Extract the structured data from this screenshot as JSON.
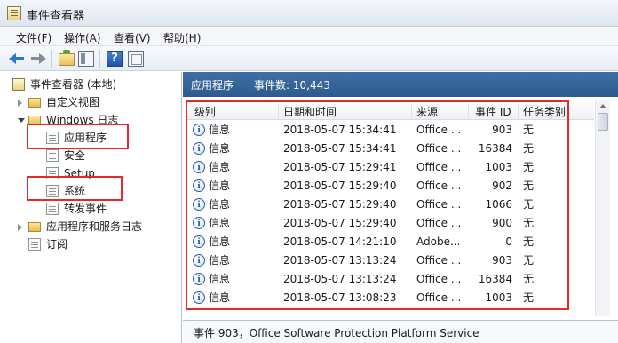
{
  "window": {
    "title": "事件查看器"
  },
  "menu": [
    {
      "label": "文件(F)"
    },
    {
      "label": "操作(A)"
    },
    {
      "label": "查看(V)"
    },
    {
      "label": "帮助(H)"
    }
  ],
  "toolbar": {
    "help_glyph": "?"
  },
  "tree": {
    "root": "事件查看器 (本地)",
    "custom_views": "自定义视图",
    "windows_logs": "Windows 日志",
    "application": "应用程序",
    "security": "安全",
    "setup": "Setup",
    "system": "系统",
    "forwarded": "转发事件",
    "app_service_logs": "应用程序和服务日志",
    "subscriptions": "订阅"
  },
  "panel": {
    "title": "应用程序",
    "event_count": "事件数: 10,443"
  },
  "columns": {
    "level": "级别",
    "datetime": "日期和时间",
    "source": "来源",
    "event_id": "事件 ID",
    "task_category": "任务类别"
  },
  "rows": [
    {
      "level": "信息",
      "datetime": "2018-05-07 15:34:41",
      "source": "Office ...",
      "event_id": "903",
      "task": "无"
    },
    {
      "level": "信息",
      "datetime": "2018-05-07 15:34:41",
      "source": "Office ...",
      "event_id": "16384",
      "task": "无"
    },
    {
      "level": "信息",
      "datetime": "2018-05-07 15:29:41",
      "source": "Office ...",
      "event_id": "1003",
      "task": "无"
    },
    {
      "level": "信息",
      "datetime": "2018-05-07 15:29:40",
      "source": "Office ...",
      "event_id": "902",
      "task": "无"
    },
    {
      "level": "信息",
      "datetime": "2018-05-07 15:29:40",
      "source": "Office ...",
      "event_id": "1066",
      "task": "无"
    },
    {
      "level": "信息",
      "datetime": "2018-05-07 15:29:40",
      "source": "Office ...",
      "event_id": "900",
      "task": "无"
    },
    {
      "level": "信息",
      "datetime": "2018-05-07 14:21:10",
      "source": "Adobe...",
      "event_id": "0",
      "task": "无"
    },
    {
      "level": "信息",
      "datetime": "2018-05-07 13:13:24",
      "source": "Office ...",
      "event_id": "903",
      "task": "无"
    },
    {
      "level": "信息",
      "datetime": "2018-05-07 13:13:24",
      "source": "Office ...",
      "event_id": "16384",
      "task": "无"
    },
    {
      "level": "信息",
      "datetime": "2018-05-07 13:08:23",
      "source": "Office ...",
      "event_id": "1003",
      "task": "无"
    }
  ],
  "detail": {
    "text": "事件 903，Office Software Protection Platform Service"
  },
  "colors": {
    "highlight": "#e52a2a",
    "panel_header": "#2e5b8d"
  }
}
